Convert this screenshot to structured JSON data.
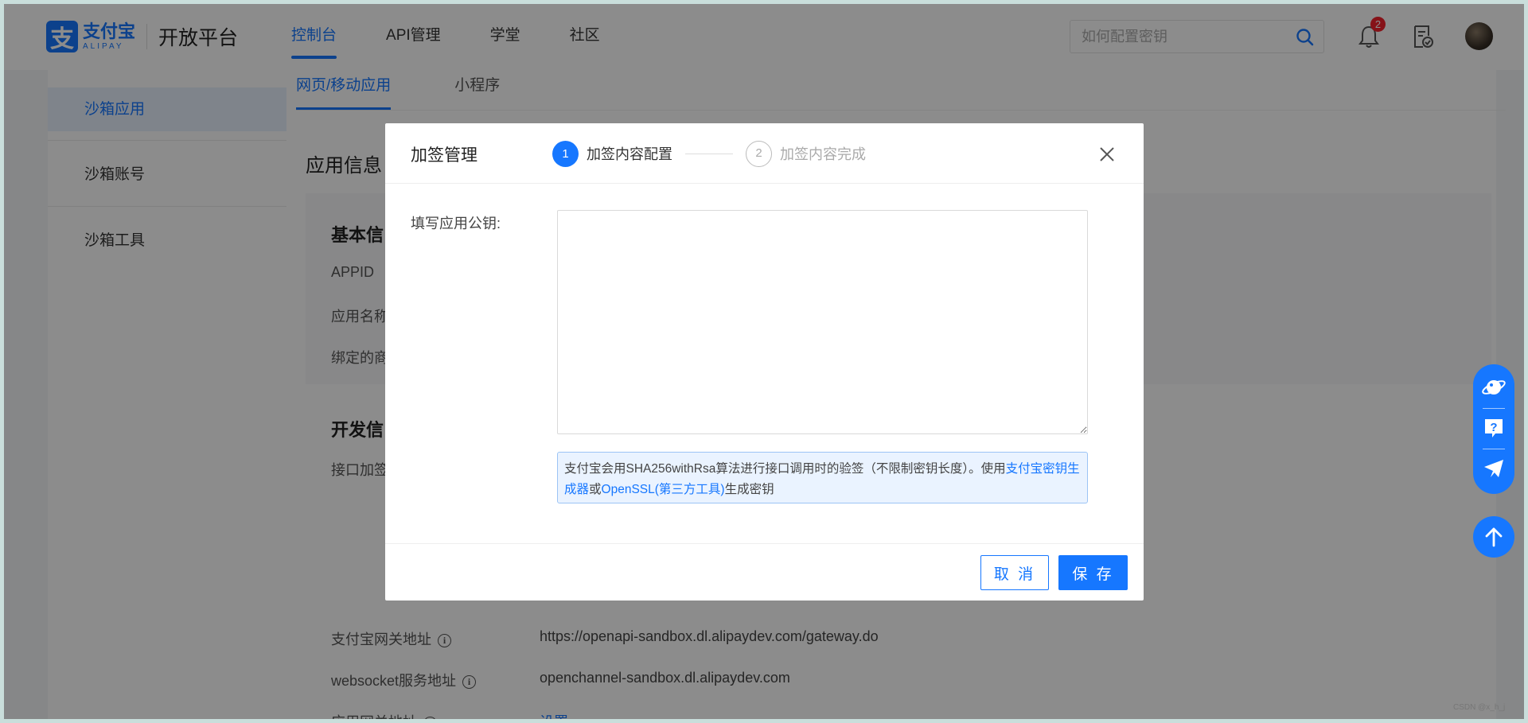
{
  "header": {
    "logo_cn": "支付宝",
    "logo_en": "ALIPAY",
    "platform": "开放平台",
    "nav": [
      {
        "label": "控制台"
      },
      {
        "label": "API管理"
      },
      {
        "label": "学堂"
      },
      {
        "label": "社区"
      }
    ],
    "search_placeholder": "如何配置密钥",
    "notification_count": "2"
  },
  "sidebar": {
    "items": [
      {
        "label": "沙箱应用"
      },
      {
        "label": "沙箱账号"
      },
      {
        "label": "沙箱工具"
      }
    ]
  },
  "main": {
    "tabs": [
      {
        "label": "网页/移动应用"
      },
      {
        "label": "小程序"
      }
    ],
    "section_title": "应用信息",
    "basic_head": "基本信",
    "basic_rows": [
      "APPID",
      "应用名称",
      "绑定的商"
    ],
    "dev_head": "开发信",
    "dev_rows": [
      "接口加签"
    ],
    "gateway_label": "支付宝网关地址",
    "gateway_value": "https://openapi-sandbox.dl.alipaydev.com/gateway.do",
    "websocket_label": "websocket服务地址",
    "websocket_value": "openchannel-sandbox.dl.alipaydev.com",
    "app_gateway_label": "应用网关地址",
    "app_gateway_value": "设置"
  },
  "modal": {
    "title": "加签管理",
    "steps": [
      {
        "number": "1",
        "label": "加签内容配置"
      },
      {
        "number": "2",
        "label": "加签内容完成"
      }
    ],
    "field_label": "填写应用公钥:",
    "textarea_value": "",
    "hint_prefix": "支付宝会用SHA256withRsa算法进行接口调用时的验签（不限制密钥长度）。使用",
    "hint_link1": "支付宝密钥生成器",
    "hint_mid": "或",
    "hint_link2": "OpenSSL(第三方工具)",
    "hint_suffix": "生成密钥",
    "cancel_label": "取 消",
    "save_label": "保 存"
  },
  "watermark": "CSDN @x_h_j",
  "colors": {
    "accent": "#1677ff",
    "badge": "#f5222d"
  }
}
